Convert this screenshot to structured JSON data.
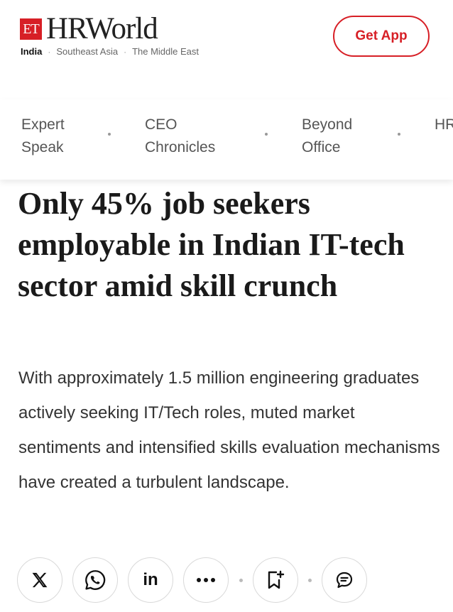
{
  "header": {
    "logo_badge": "ET",
    "logo_text": "HRWorld",
    "regions": [
      "India",
      "Southeast Asia",
      "The Middle East"
    ],
    "active_region": "India",
    "get_app_label": "Get App",
    "accent_color": "#d71f26"
  },
  "nav": {
    "items": [
      {
        "line1": "Expert",
        "line2": "Speak"
      },
      {
        "line1": "CEO",
        "line2": "Chronicles"
      },
      {
        "line1": "Beyond",
        "line2": "Office"
      },
      {
        "line1": "HR",
        "line2": ""
      }
    ]
  },
  "article": {
    "headline": "Only 45% job seekers employable in Indian IT-tech sector amid skill crunch",
    "summary": "With approximately 1.5 million engineering graduates actively seeking IT/Tech roles, muted market sentiments and intensified skills evaluation mechanisms have created a turbulent landscape."
  },
  "share": {
    "buttons": [
      {
        "icon": "x-twitter-icon"
      },
      {
        "icon": "whatsapp-icon"
      },
      {
        "icon": "linkedin-icon",
        "label": "in"
      },
      {
        "icon": "more-icon"
      },
      {
        "icon": "bookmark-add-icon"
      },
      {
        "icon": "comment-icon"
      }
    ]
  }
}
